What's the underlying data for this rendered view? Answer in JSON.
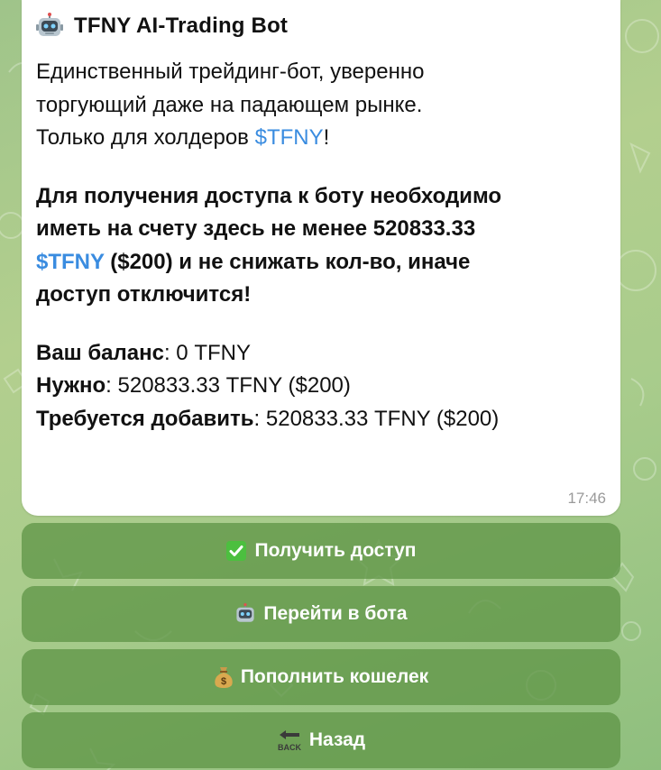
{
  "message": {
    "title": "TFNY AI-Trading Bot",
    "title_icon": "robot-icon",
    "intro_line1": "Единственный трейдинг-бот, уверенно",
    "intro_line2": "торгующий даже на падающем рынке.",
    "intro_line3_prefix": "Только для холдеров ",
    "intro_line3_link": "$TFNY",
    "intro_line3_suffix": "!",
    "req_line1": "Для получения доступа к боту необходимо",
    "req_line2": "иметь на счету здесь не менее 520833.33",
    "req_line3_link": "$TFNY",
    "req_line3_rest": " ($200) и не снижать кол-во, иначе",
    "req_line4": "доступ отключится!",
    "balance_label": "Ваш баланс",
    "balance_value": ": 0 TFNY",
    "needed_label": "Нужно",
    "needed_value": ": 520833.33 TFNY ($200)",
    "add_label": "Требуется добавить",
    "add_value": ": 520833.33 TFNY ($200)",
    "time": "17:46"
  },
  "buttons": [
    {
      "label": "Получить доступ",
      "icon": "check-mark-icon"
    },
    {
      "label": "Перейти в бота",
      "icon": "robot-icon"
    },
    {
      "label": "Пополнить кошелек",
      "icon": "money-bag-icon"
    },
    {
      "label": "Назад",
      "icon": "back-arrow-icon"
    }
  ],
  "colors": {
    "link": "#3a8ce0",
    "button_bg": "#6a9a4f",
    "background": "#a9cc8c"
  }
}
